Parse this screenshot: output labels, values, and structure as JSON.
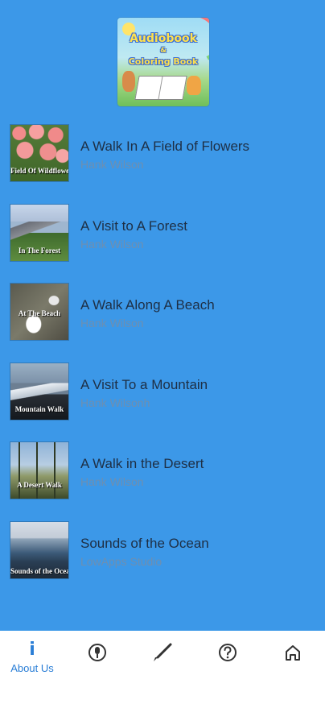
{
  "header": {
    "logo": {
      "line1": "Audiobook",
      "line2": "&",
      "line3": "Coloring Book"
    }
  },
  "books": [
    {
      "title": "A Walk In A Field of Flowers",
      "author": "Hank Wilson",
      "thumb_caption": "Field Of Wildflowers",
      "thumb_style": "flowers"
    },
    {
      "title": "A Visit to A Forest",
      "author": "Hank Wilson",
      "thumb_caption": "In The Forest",
      "thumb_style": "forest"
    },
    {
      "title": "A Walk Along A Beach",
      "author": "Hank Wilson",
      "thumb_caption": "At The Beach",
      "thumb_style": "beach"
    },
    {
      "title": "A Visit To a Mountain",
      "author": "Hank Wilsonh",
      "thumb_caption": "Mountain Walk",
      "thumb_style": "mountain"
    },
    {
      "title": "A Walk in the Desert",
      "author": "Hank Wilson",
      "thumb_caption": "A Desert Walk",
      "thumb_style": "desert"
    },
    {
      "title": "Sounds of the Ocean",
      "author": "LowApps Studio",
      "thumb_caption": "Sounds of the Ocean",
      "thumb_style": "ocean"
    }
  ],
  "bottom_nav": {
    "items": [
      {
        "label": "About Us",
        "icon": "info-icon",
        "active": true
      },
      {
        "label": "",
        "icon": "microphone-icon"
      },
      {
        "label": "",
        "icon": "paintbrush-icon"
      },
      {
        "label": "",
        "icon": "help-icon"
      },
      {
        "label": "",
        "icon": "home-icon"
      }
    ]
  },
  "colors": {
    "background": "#3c98e8",
    "title_text": "#1e2f45",
    "author_text": "#6e8fb0",
    "nav_active": "#2a7ed6",
    "nav_icon": "#333333"
  }
}
